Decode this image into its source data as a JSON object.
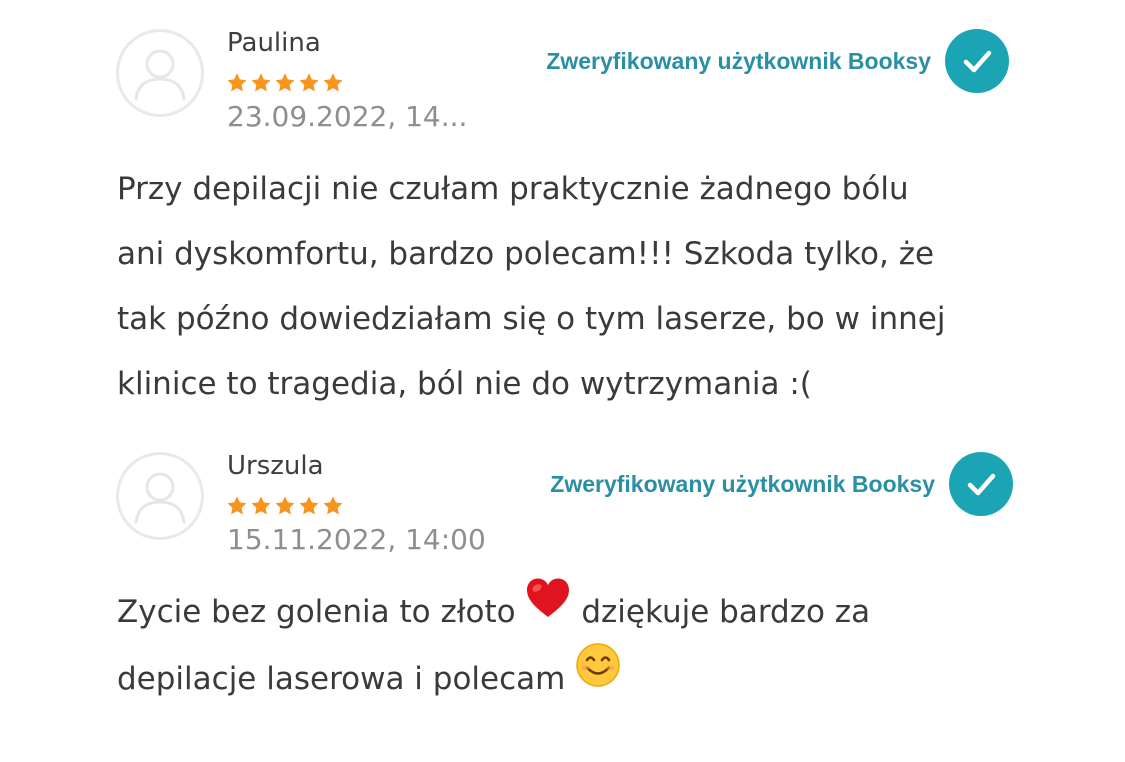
{
  "reviews": [
    {
      "author": "Paulina",
      "rating": 5,
      "date": "23.09.2022, 14...",
      "verified_label": "Zweryfikowany użytkownik Booksy",
      "text": "Przy depilacji nie czułam praktycznie żadnego bólu\nani dyskomfortu, bardzo polecam!!! Szkoda tylko, że\ntak późno dowiedziałam się o tym laserze, bo w innej\nklinice to tragedia, ból nie do wytrzymania :("
    },
    {
      "author": "Urszula",
      "rating": 5,
      "date": "15.11.2022, 14:00",
      "verified_label": "Zweryfikowany użytkownik Booksy",
      "text_part1": "Zycie bez golenia to złoto ",
      "text_part2": " dziękuje bardzo za\ndepilacje laserowa i polecam ",
      "emoji_1": "red-heart-emoji",
      "emoji_2": "smiling-face-emoji"
    }
  ],
  "icons": {
    "avatar": "user-avatar-icon",
    "star": "star-icon",
    "check": "check-icon"
  },
  "colors": {
    "star": "#f7941d",
    "verified_text": "#2a8fa5",
    "badge": "#1ba5b4",
    "date": "#8e8e8e",
    "text": "#3a3a3a"
  }
}
